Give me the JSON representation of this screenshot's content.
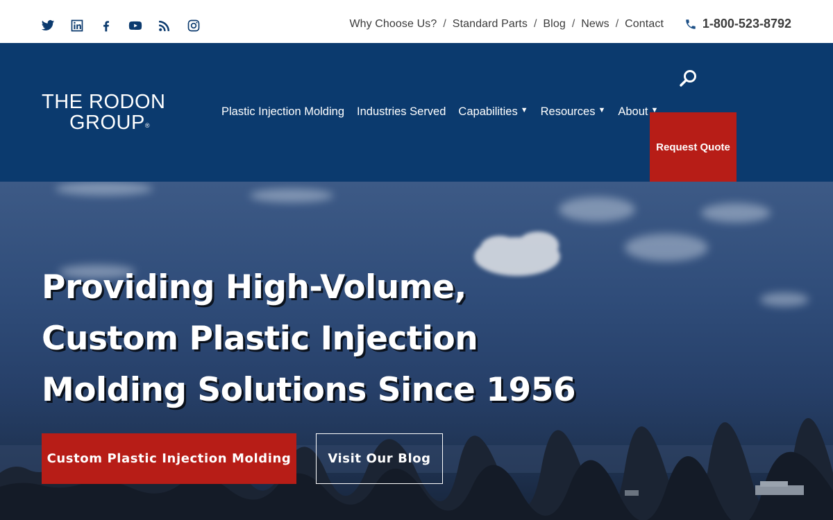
{
  "social": [
    {
      "name": "twitter-icon"
    },
    {
      "name": "linkedin-icon"
    },
    {
      "name": "facebook-icon"
    },
    {
      "name": "youtube-icon"
    },
    {
      "name": "rss-icon"
    },
    {
      "name": "instagram-icon"
    }
  ],
  "utility_nav": {
    "items": [
      "Why Choose Us?",
      "Standard Parts",
      "Blog",
      "News",
      "Contact"
    ],
    "separator": "/"
  },
  "phone": {
    "icon": "phone-icon",
    "number": "1-800-523-8792"
  },
  "logo": {
    "line1": "THE RODON",
    "line2": "GROUP",
    "mark": "®"
  },
  "main_nav": {
    "items": [
      {
        "label": "Plastic Injection Molding",
        "dropdown": false
      },
      {
        "label": "Industries Served",
        "dropdown": false
      },
      {
        "label": "Capabilities",
        "dropdown": true
      },
      {
        "label": "Resources",
        "dropdown": true
      },
      {
        "label": "About",
        "dropdown": true
      }
    ],
    "caret": "▼"
  },
  "search": {
    "icon": "search-icon"
  },
  "request_quote": {
    "label": "Request Quote"
  },
  "hero": {
    "headline": [
      "Providing High-Volume,",
      "Custom Plastic Injection",
      "Molding Solutions Since 1956"
    ],
    "cta_primary": "Custom Plastic Injection Molding",
    "cta_secondary": "Visit Our Blog"
  },
  "colors": {
    "brand_blue": "#0b3a6e",
    "brand_red": "#b71d17",
    "text_dark": "#3a3a3a",
    "white": "#ffffff"
  }
}
